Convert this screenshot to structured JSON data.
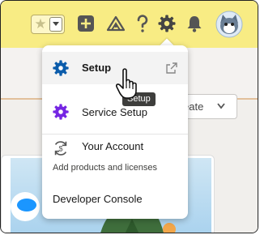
{
  "colors": {
    "topbar": "#f8ec84",
    "icon_dark": "#444444",
    "setup_blue": "#0b5cab",
    "service_purple": "#7526e3"
  },
  "header": {
    "icons": [
      "star-icon",
      "chevron-down-icon",
      "add-icon",
      "trailhead-icon",
      "help-icon",
      "gear-icon",
      "bell-icon",
      "avatar"
    ]
  },
  "background": {
    "create_button_label": "eate"
  },
  "setup_menu": {
    "items": [
      {
        "label": "Setup",
        "icon": "gear-icon",
        "trailing_icon": "open-external-icon"
      },
      {
        "label": "Service Setup",
        "icon": "gear-icon"
      },
      {
        "label": "Your Account",
        "icon": "account-sync-icon",
        "sublabel": "Add products and licenses"
      },
      {
        "label": "Developer Console"
      }
    ]
  },
  "tooltip": {
    "text": "Setup"
  }
}
